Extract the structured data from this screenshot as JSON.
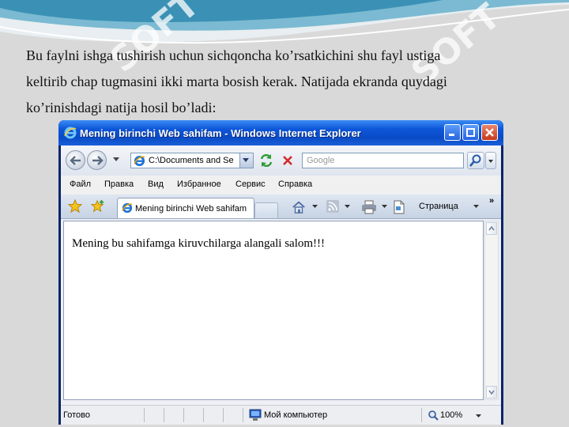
{
  "slide": {
    "paragraph_lines": [
      "Bu faylni ishga tushirish uchun sichqoncha ko’rsatkichini shu fayl ustiga",
      "keltirib chap tugmasini ikki marta bosish kerak. Natijada ekranda quydagi",
      "ko’rinishdagi natija hosil bo’ladi:"
    ],
    "watermark_text": "SOFT"
  },
  "browser": {
    "title": "Mening birinchi Web sahifam - Windows Internet Explorer",
    "address": "C:\\Documents and Se",
    "search_placeholder": "Google",
    "menu": [
      "Файл",
      "Правка",
      "Вид",
      "Избранное",
      "Сервис",
      "Справка"
    ],
    "tab_label": "Mening birinchi Web sahifam",
    "page_menu": "Страница",
    "more": "»",
    "page_content": "Mening bu sahifamga kiruvchilarga alangali salom!!!",
    "status": {
      "text": "Готово",
      "zone": "Мой компьютер",
      "zoom": "100%"
    }
  },
  "colors": {
    "titlebar": "#0d56d8",
    "watermark": "#ffffff",
    "swoosh": "#5aa9c9"
  },
  "icons": [
    "back-icon",
    "forward-icon",
    "ie-logo-icon",
    "refresh-icon",
    "stop-icon",
    "search-icon",
    "favorites-star-icon",
    "add-favorites-icon",
    "home-icon",
    "rss-icon",
    "print-icon",
    "page-icon",
    "computer-icon",
    "zoom-icon"
  ]
}
